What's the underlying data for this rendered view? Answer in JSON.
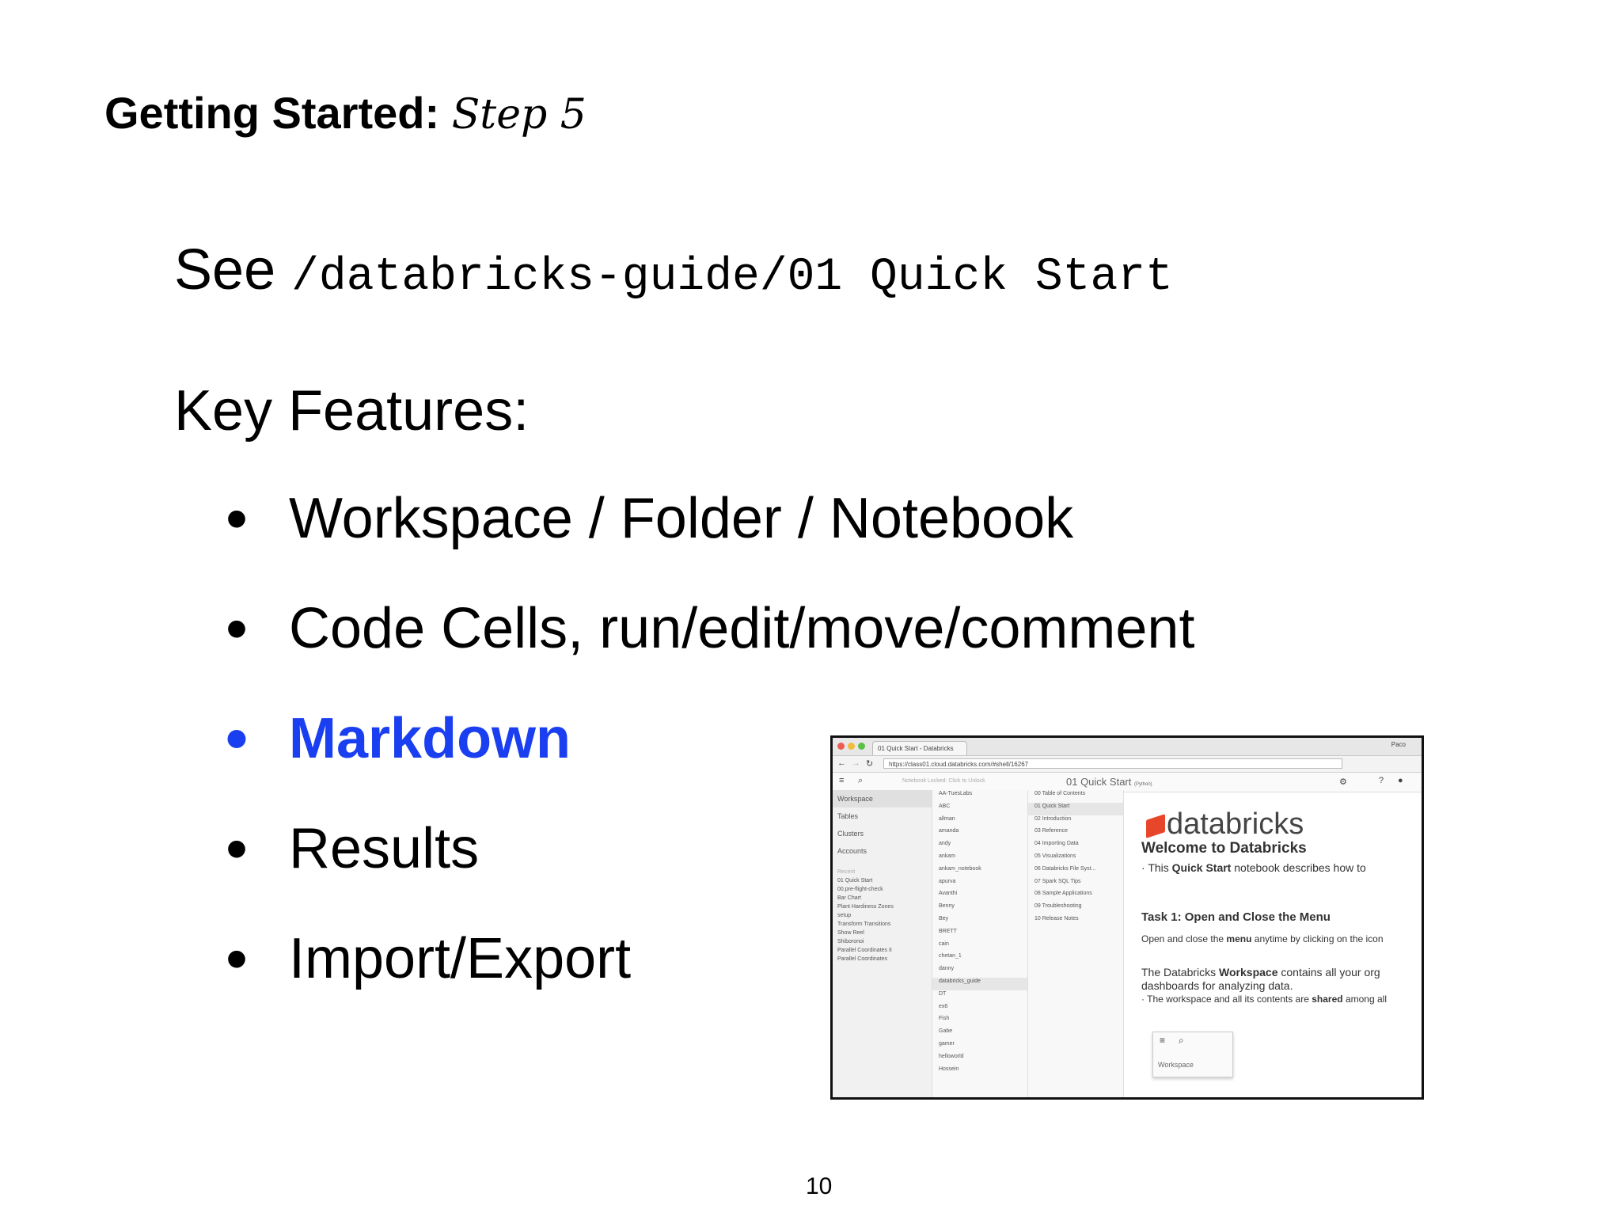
{
  "slide": {
    "title_bold": "Getting Started:",
    "title_italic": "Step 5",
    "see_label": "See",
    "see_path": "/databricks-guide/01 Quick Start",
    "key_features": "Key Features:",
    "bullets": [
      "Workspace / Folder / Notebook",
      "Code Cells, run/edit/move/comment",
      "Markdown",
      "Results",
      "Import/Export"
    ],
    "highlight_color": "#1a3ff0",
    "page_number": "10"
  },
  "screenshot": {
    "tab_title": "01 Quick Start - Databricks",
    "user": "Paco",
    "url": "https://class01.cloud.databricks.com/#shell/16267",
    "lock_text": "Notebook Locked: Click to Unlock",
    "notebook_title": "01 Quick Start",
    "notebook_lang": "(Python)",
    "sidebar": [
      "Workspace",
      "Tables",
      "Clusters",
      "Accounts"
    ],
    "recent_label": "Recent",
    "recent": [
      "01 Quick Start",
      "00.pre-flight-check",
      "Bar Chart",
      "Plant Hardiness Zones",
      "setup",
      "Transform Transitions",
      "Show Reel",
      "Shiboronoi",
      "Parallel Coordinates II",
      "Parallel Coordinates"
    ],
    "folders": [
      "AA-TuesLabs",
      "ABC",
      "allman",
      "amanda",
      "andy",
      "ankam",
      "ankam_notebook",
      "apurva",
      "Avanthi",
      "Benny",
      "Bey",
      "BRETT",
      "cain",
      "chetan_1",
      "danny",
      "databricks_guide",
      "DT",
      "ex6",
      "Fish",
      "Gabe",
      "gamer",
      "helloworld",
      "Hossein"
    ],
    "guide": [
      "00 Table of Contents",
      "01 Quick Start",
      "02 Introduction",
      "03 Reference",
      "04 Importing Data",
      "05 Visualizations",
      "06 Databricks File Syst...",
      "07 Spark SQL Tips",
      "08 Sample Applications",
      "09 Troubleshooting",
      "10 Release Notes"
    ],
    "logo_text": "databricks",
    "welcome": "Welcome to Databricks",
    "intro_pre": "This",
    "intro_bold": "Quick Start",
    "intro_post": "notebook describes how to",
    "task1": "Task 1: Open and Close the Menu",
    "task1_pre": "Open and close the",
    "task1_bold": "menu",
    "task1_post": "anytime by clicking on the icon",
    "ws_pre": "The Databricks",
    "ws_bold": "Workspace",
    "ws_post": "contains all your org",
    "ws_line2": "dashboards for analyzing data.",
    "shared_pre": "The workspace and all its contents are",
    "shared_bold": "shared",
    "shared_post": "among all",
    "menu_workspace": "Workspace"
  }
}
